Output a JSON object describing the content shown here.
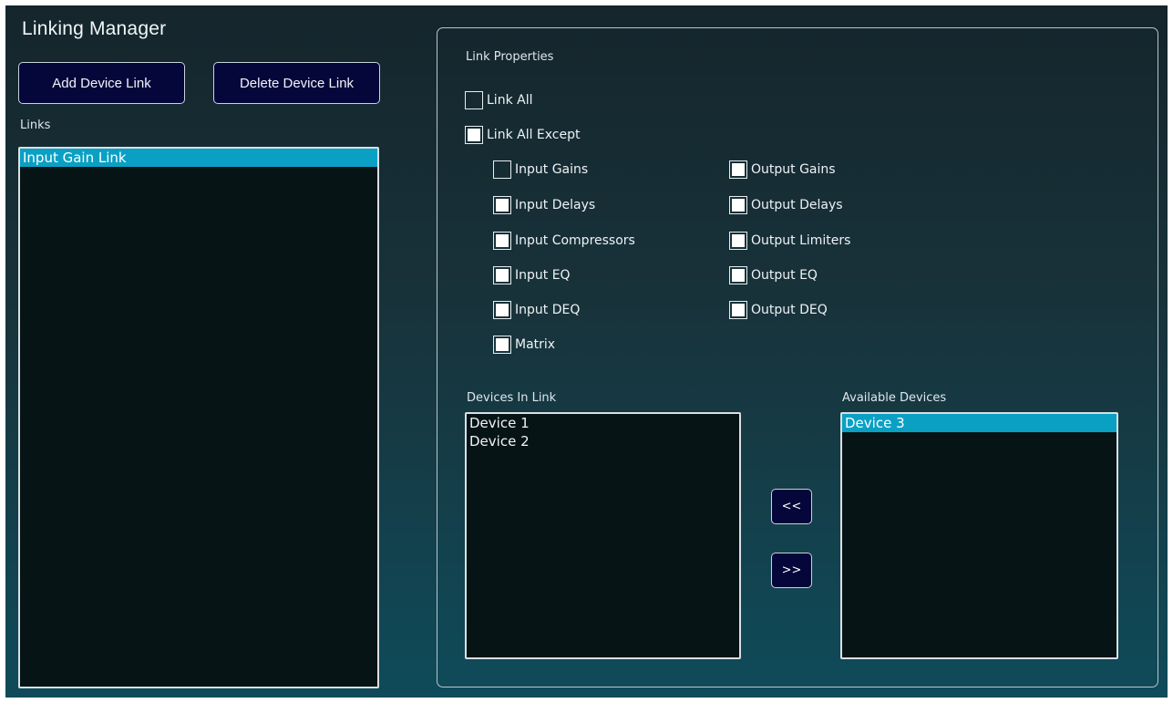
{
  "window": {
    "title": "Linking Manager"
  },
  "toolbar": {
    "add_label": "Add Device Link",
    "delete_label": "Delete Device Link"
  },
  "links": {
    "label": "Links",
    "items": [
      {
        "label": "Input Gain Link",
        "selected": true
      }
    ]
  },
  "properties": {
    "label": "Link Properties",
    "link_all": {
      "label": "Link All",
      "checked": false
    },
    "link_all_except": {
      "label": "Link All Except",
      "checked": true
    },
    "left_options": [
      {
        "label": "Input Gains",
        "checked": false
      },
      {
        "label": "Input Delays",
        "checked": true
      },
      {
        "label": "Input Compressors",
        "checked": true
      },
      {
        "label": "Input EQ",
        "checked": true
      },
      {
        "label": "Input DEQ",
        "checked": true
      },
      {
        "label": "Matrix",
        "checked": true
      }
    ],
    "right_options": [
      {
        "label": "Output Gains",
        "checked": true
      },
      {
        "label": "Output Delays",
        "checked": true
      },
      {
        "label": "Output Limiters",
        "checked": true
      },
      {
        "label": "Output EQ",
        "checked": true
      },
      {
        "label": "Output DEQ",
        "checked": true
      }
    ]
  },
  "devices_in_link": {
    "label": "Devices In Link",
    "items": [
      {
        "label": "Device 1"
      },
      {
        "label": "Device 2"
      }
    ]
  },
  "available_devices": {
    "label": "Available Devices",
    "items": [
      {
        "label": "Device 3",
        "selected": true
      }
    ]
  },
  "transfer": {
    "move_left_label": "<<",
    "move_right_label": ">>"
  },
  "colors": {
    "selection": "#0aa0c4",
    "button_bg": "#05063a"
  }
}
